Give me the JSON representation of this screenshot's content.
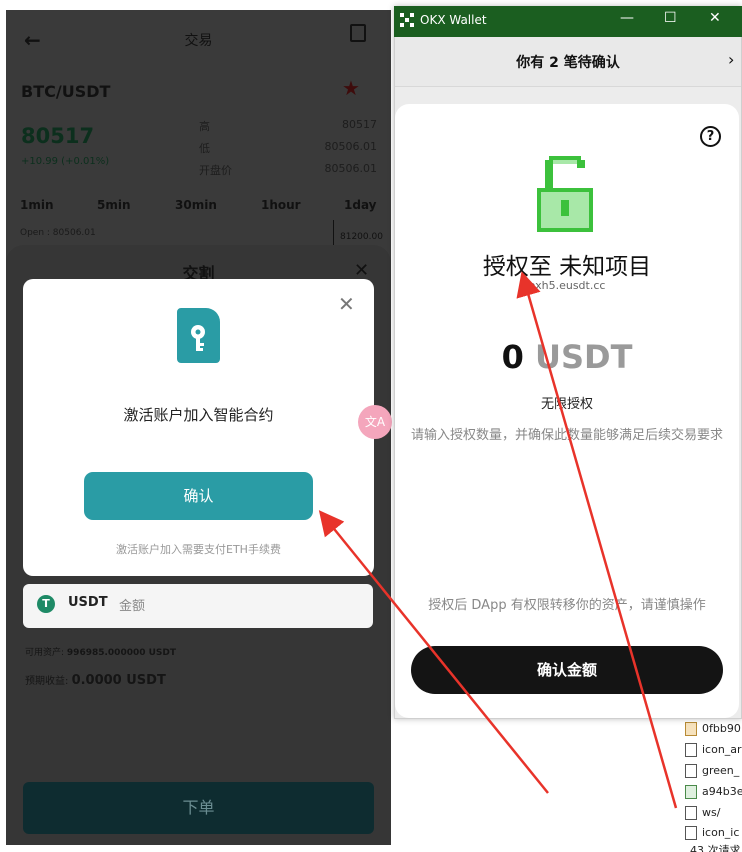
{
  "phone": {
    "header_title": "交易",
    "pair": "BTC/USDT",
    "price": "80517",
    "change": "+10.99 (+0.01%)",
    "stats": [
      {
        "label": "高",
        "value": "80517"
      },
      {
        "label": "低",
        "value": "80506.01"
      },
      {
        "label": "开盘价",
        "value": "80506.01"
      }
    ],
    "timeframes": [
      "1min",
      "5min",
      "30min",
      "1hour",
      "1day"
    ],
    "open_label": "Open : 80506.01",
    "chart_value": "81200.00",
    "sheet_title": "交割",
    "field_unit": "USDT",
    "field_placeholder": "金额",
    "usdt_symbol": "T",
    "available_label": "可用资产:",
    "available_value": "996985.000000 USDT",
    "expected_label": "预期收益:",
    "expected_value": "0.0000 USDT",
    "order_button": "下单"
  },
  "modal": {
    "message": "激活账户加入智能合约",
    "confirm_button": "确认",
    "note": "激活账户加入需要支付ETH手续费",
    "icon": "key-file-icon",
    "accent": "#2a9ca5"
  },
  "translate_bubble": "文A",
  "wallet": {
    "title": "OKX Wallet",
    "pending_text": "你有 2 笔待确认",
    "help_symbol": "?",
    "auth_title": "授权至 未知项目",
    "site": "exh5.eusdt.cc",
    "amount_number": "0",
    "amount_unit": "USDT",
    "unlimited": "无限授权",
    "hint": "请输入授权数量，并确保此数量能够满足后续交易要求",
    "warning": "授权后 DApp 有权限转移你的资产，请谨慎操作",
    "confirm_button": "确认金额",
    "lock_color": "#3cc13c"
  },
  "files": [
    "0fbb90",
    "icon_ar",
    "green_",
    "a94b3e",
    "ws/",
    "icon_ic"
  ],
  "footer_text": "43 次请求"
}
